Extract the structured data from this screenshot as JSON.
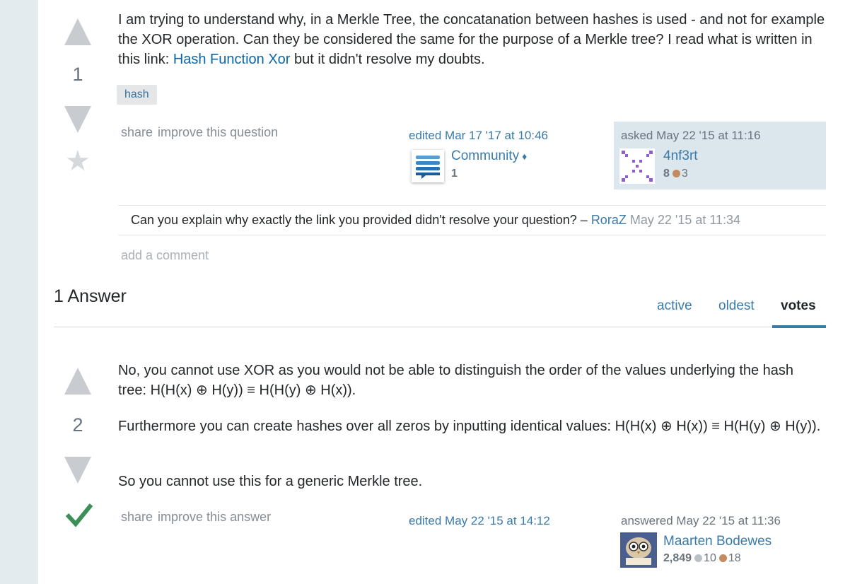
{
  "question": {
    "vote_count": "1",
    "body_part1": "I am trying to understand why, in a Merkle Tree, the concatanation between hashes is used - and not for example the XOR operation. Can they be considered the same for the purpose of a Merkle tree? I read what is written in this link: ",
    "link_text": "Hash Function Xor",
    "body_part2": " but it didn't resolve my doubts.",
    "tags": [
      "hash"
    ],
    "menu": {
      "share": "share",
      "improve": "improve this question"
    },
    "edited": {
      "action": "edited Mar 17 '17 at 10:46",
      "user": "Community",
      "diamond": "♦",
      "rep": "1"
    },
    "asked": {
      "action": "asked May 22 '15 at 11:16",
      "user": "4nf3rt",
      "rep": "8",
      "bronze": "3"
    },
    "comments": [
      {
        "text": "Can you explain why exactly the link you provided didn't resolve your question? – ",
        "user": "RoraZ",
        "date": "May 22 '15 at 11:34"
      }
    ],
    "add_comment": "add a comment"
  },
  "answers_header": {
    "title": "1 Answer",
    "tabs": [
      "active",
      "oldest",
      "votes"
    ],
    "selected_tab": "votes"
  },
  "answer": {
    "vote_count": "2",
    "paragraphs": [
      "No, you cannot use XOR as you would not be able to distinguish the order of the values underlying the hash tree: H(H(x) ⊕ H(y)) ≡ H(H(y) ⊕ H(x)).",
      "Furthermore you can create hashes over all zeros by inputting identical values: H(H(x) ⊕ H(x)) ≡ H(H(y) ⊕ H(y)).",
      "So you cannot use this for a generic Merkle tree."
    ],
    "menu": {
      "share": "share",
      "improve": "improve this answer"
    },
    "edited": {
      "action": "edited May 22 '15 at 14:12"
    },
    "answered": {
      "action": "answered May 22 '15 at 11:36",
      "user": "Maarten Bodewes",
      "rep": "2,849",
      "silver": "10",
      "bronze": "18"
    }
  },
  "colors": {
    "link": "#3a7aa8",
    "accepted": "#3d8f58",
    "tab_underline": "#3a7aa8",
    "owner_bg": "#dbe6ed"
  }
}
